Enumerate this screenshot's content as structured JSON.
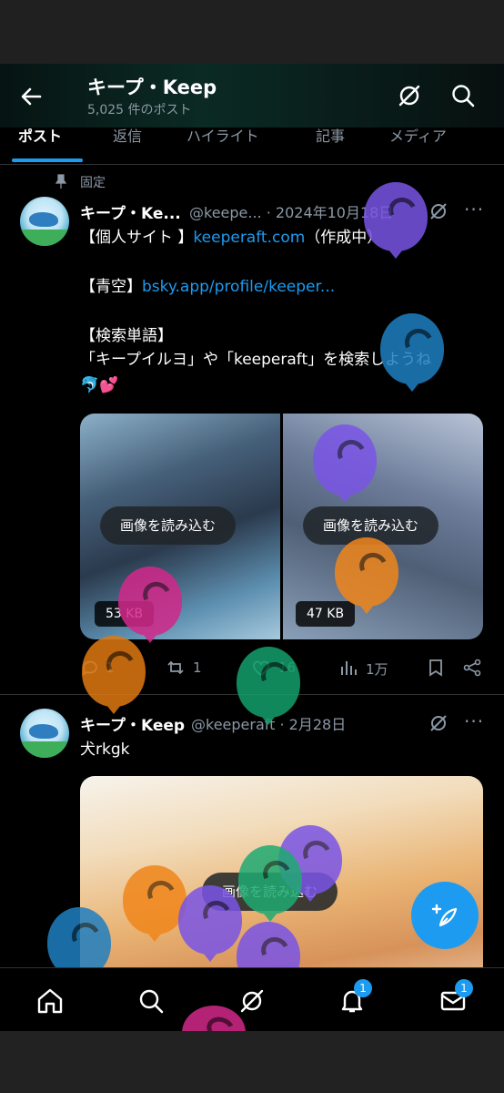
{
  "header": {
    "title": "キープ・Keep",
    "subtitle": "5,025 件のポスト"
  },
  "tabs": [
    "ポスト",
    "返信",
    "ハイライト",
    "記事",
    "メディア"
  ],
  "posts": [
    {
      "pinned_label": "固定",
      "name": "キープ・Ke...",
      "handle": "@keepe... · 2024年10月18日",
      "lines": [
        {
          "pre": "【個人サイト 】",
          "link": "keeperaft.com",
          "post": "（作成中）"
        },
        {
          "pre": "【青空】",
          "link": "bsky.app/profile/keeper...",
          "post": ""
        },
        {
          "pre": "【検索単語】",
          "link": "",
          "post": ""
        },
        {
          "pre": "「キープイルヨ」や「keeperaft」を検索しようね",
          "link": "",
          "post": ""
        },
        {
          "pre": "🐬💕",
          "link": "",
          "post": ""
        }
      ],
      "media": [
        {
          "load_label": "画像を読み込む",
          "size": "53 KB"
        },
        {
          "load_label": "画像を読み込む",
          "size": "47 KB"
        }
      ],
      "actions": {
        "replies": "1",
        "reposts": "1",
        "likes": "16",
        "views": "1万"
      }
    },
    {
      "name": "キープ・Keep",
      "handle": "@keeperaft · 2月28日",
      "text": "犬rkgk",
      "media": [
        {
          "load_label": "画像を読み込む"
        }
      ]
    }
  ],
  "nav": {
    "notifications_badge": "1",
    "messages_badge": "1"
  },
  "colors": {
    "accent": "#1d9bf0",
    "background": "#000000",
    "muted": "#8b98a5"
  },
  "icons": [
    "back-arrow-icon",
    "grok-icon",
    "search-icon",
    "pin-icon",
    "more-icon",
    "reply-icon",
    "repost-icon",
    "like-icon",
    "views-icon",
    "bookmark-icon",
    "share-icon",
    "compose-icon",
    "home-icon",
    "notifications-icon",
    "messages-icon"
  ]
}
